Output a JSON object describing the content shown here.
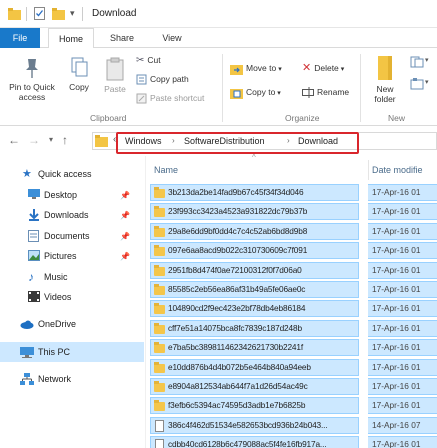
{
  "window": {
    "title": "Download"
  },
  "tabs": {
    "file": "File",
    "home": "Home",
    "share": "Share",
    "view": "View"
  },
  "ribbon": {
    "pin_label_1": "Pin to Quick",
    "pin_label_2": "access",
    "copy": "Copy",
    "paste": "Paste",
    "cut": "Cut",
    "copy_path": "Copy path",
    "paste_shortcut": "Paste shortcut",
    "clipboard_group": "Clipboard",
    "move_to": "Move to",
    "copy_to": "Copy to",
    "delete": "Delete",
    "rename": "Rename",
    "organize_group": "Organize",
    "new_folder_1": "New",
    "new_folder_2": "folder",
    "new_group": "New",
    "colors": {
      "delete_x": "#d13438",
      "file_tab": "#1979ca",
      "folder": "#f3c544"
    }
  },
  "address": {
    "overflow": "«",
    "crumbs": [
      "Windows",
      "SoftwareDistribution",
      "Download"
    ],
    "highlight_color": "#d9262c"
  },
  "nav": {
    "items": [
      {
        "label": "Quick access",
        "icon": "star-icon",
        "pinned": false
      },
      {
        "label": "Desktop",
        "icon": "desktop-icon",
        "pinned": true
      },
      {
        "label": "Downloads",
        "icon": "download-arrow-icon",
        "pinned": true
      },
      {
        "label": "Documents",
        "icon": "documents-icon",
        "pinned": true
      },
      {
        "label": "Pictures",
        "icon": "pictures-icon",
        "pinned": true
      },
      {
        "label": "Music",
        "icon": "music-note-icon",
        "pinned": false
      },
      {
        "label": "Videos",
        "icon": "videos-icon",
        "pinned": false
      },
      {
        "label": "OneDrive",
        "icon": "cloud-icon",
        "pinned": false
      },
      {
        "label": "This PC",
        "icon": "computer-icon",
        "pinned": false
      },
      {
        "label": "Network",
        "icon": "network-icon",
        "pinned": false
      }
    ],
    "selected": "This PC"
  },
  "filelist": {
    "columns": {
      "name": "Name",
      "date": "Date modifie"
    },
    "rows": [
      {
        "type": "folder",
        "name": "3b213da2be14fad9b67c45f34f34d046",
        "date": "17-Apr-16 01"
      },
      {
        "type": "folder",
        "name": "23f993cc3423a4523a931822dc79b37b",
        "date": "17-Apr-16 01"
      },
      {
        "type": "folder",
        "name": "29a8e6dd9bf0dd4c7c4c52ab6bd8d9b8",
        "date": "17-Apr-16 01"
      },
      {
        "type": "folder",
        "name": "097e6aa8acd9b022c310730609c7f091",
        "date": "17-Apr-16 01"
      },
      {
        "type": "folder",
        "name": "2951fb8d474f0ae72100312f0f7d06a0",
        "date": "17-Apr-16 01"
      },
      {
        "type": "folder",
        "name": "85585c2eb56ea86af31b49a5fe06ae0c",
        "date": "17-Apr-16 01"
      },
      {
        "type": "folder",
        "name": "104890cd2f9ec423e2bf78db4eb86184",
        "date": "17-Apr-16 01"
      },
      {
        "type": "folder",
        "name": "cff7e51a14075bca8fc7839c187d248b",
        "date": "17-Apr-16 01"
      },
      {
        "type": "folder",
        "name": "e7ba5bc389811462342621730b2241f",
        "date": "17-Apr-16 01"
      },
      {
        "type": "folder",
        "name": "e10dd876b4d4b072b5e464b840a94eeb",
        "date": "17-Apr-16 01"
      },
      {
        "type": "folder",
        "name": "e8904a812534ab644f7a1d26d54ac49c",
        "date": "17-Apr-16 01"
      },
      {
        "type": "folder",
        "name": "f3efb6c5394ac74595d3adb1e7b6825b",
        "date": "17-Apr-16 01"
      },
      {
        "type": "file",
        "name": "386c4f462d51534e582653bcd936b24b043...",
        "date": "14-Apr-16 07"
      },
      {
        "type": "file",
        "name": "cdbb40cd6128b6c479088ac5f4fe16fb917a...",
        "date": "17-Apr-16 01"
      }
    ],
    "selection_color": "#cce8ff"
  }
}
